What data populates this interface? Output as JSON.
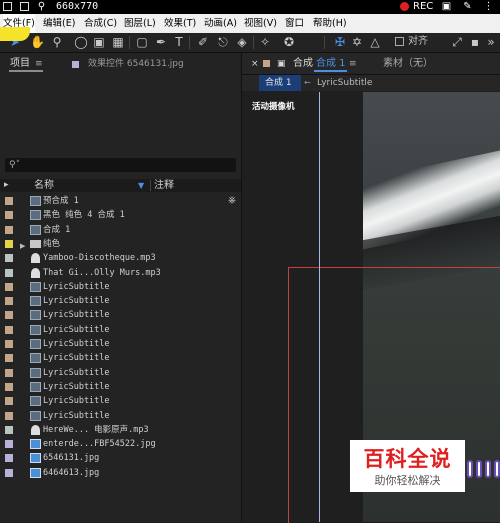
{
  "screen": {
    "dimensions": "660x770",
    "rec_label": "REC"
  },
  "menubar": {
    "items": [
      "文件(F)",
      "编辑(E)",
      "合成(C)",
      "图层(L)",
      "效果(T)",
      "动画(A)",
      "视图(V)",
      "窗口",
      "帮助(H)"
    ]
  },
  "toolbar": {
    "align_label": "对齐"
  },
  "left_panel": {
    "project_tab": "项目",
    "effects_tab": "效果控件 6546131.jpg",
    "search_placeholder": "",
    "col_name": "名称",
    "col_comment": "注释",
    "items": [
      {
        "label": "预合成 1",
        "swatch": "#c2a58a",
        "icon": "comp"
      },
      {
        "label": "黑色 纯色 4 合成 1",
        "swatch": "#c2a58a",
        "icon": "comp"
      },
      {
        "label": "合成 1",
        "swatch": "#c2a58a",
        "icon": "comp"
      },
      {
        "label": "纯色",
        "swatch": "#e6d04a",
        "icon": "folder"
      },
      {
        "label": "Yamboo-Discotheque.mp3",
        "swatch": "#b8c4c0",
        "icon": "audio"
      },
      {
        "label": "That Gi...Olly Murs.mp3",
        "swatch": "#b8c4c0",
        "icon": "audio"
      },
      {
        "label": "LyricSubtitle",
        "swatch": "#c2a58a",
        "icon": "comp"
      },
      {
        "label": "LyricSubtitle",
        "swatch": "#c2a58a",
        "icon": "comp"
      },
      {
        "label": "LyricSubtitle",
        "swatch": "#c2a58a",
        "icon": "comp"
      },
      {
        "label": "LyricSubtitle",
        "swatch": "#c2a58a",
        "icon": "comp"
      },
      {
        "label": "LyricSubtitle",
        "swatch": "#c2a58a",
        "icon": "comp"
      },
      {
        "label": "LyricSubtitle",
        "swatch": "#c2a58a",
        "icon": "comp"
      },
      {
        "label": "LyricSubtitle",
        "swatch": "#c2a58a",
        "icon": "comp"
      },
      {
        "label": "LyricSubtitle",
        "swatch": "#c2a58a",
        "icon": "comp"
      },
      {
        "label": "LyricSubtitle",
        "swatch": "#c2a58a",
        "icon": "comp"
      },
      {
        "label": "LyricSubtitle",
        "swatch": "#c2a58a",
        "icon": "comp"
      },
      {
        "label": "HereWe... 电影原声.mp3",
        "swatch": "#b8c4c0",
        "icon": "audio"
      },
      {
        "label": "enterde...FBF54522.jpg",
        "swatch": "#b9b0d8",
        "icon": "img"
      },
      {
        "label": "6546131.jpg",
        "swatch": "#b9b0d8",
        "icon": "img"
      },
      {
        "label": "6464613.jpg",
        "swatch": "#b9b0d8",
        "icon": "img"
      }
    ]
  },
  "right_panel": {
    "comp_tab_prefix": "合成",
    "comp_tab_active": "合成 1",
    "footage_tab": "素材（无）",
    "sub_tabs": [
      "合成 1",
      "LyricSubtitle"
    ],
    "camera_label": "活动摄像机"
  },
  "watermark": {
    "title": "百科全说",
    "subtitle": "助你轻松解决"
  }
}
